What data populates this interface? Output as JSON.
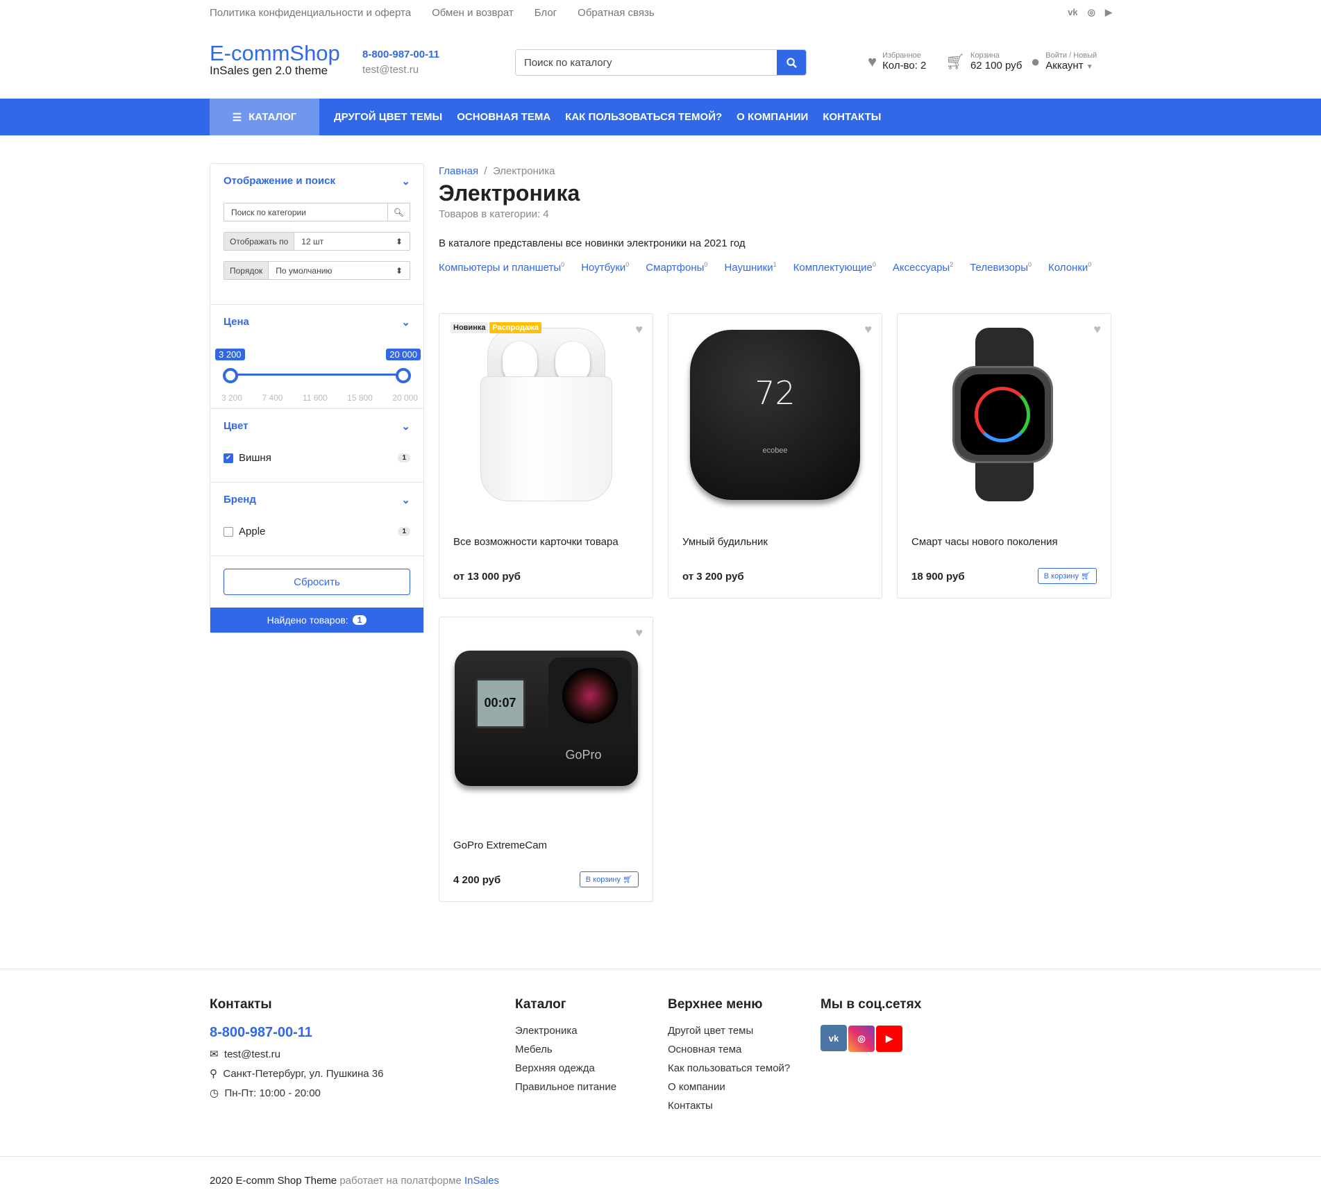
{
  "topbar": {
    "links": [
      "Политика конфиденциальности и оферта",
      "Обмен и возврат",
      "Блог",
      "Обратная связь"
    ],
    "socials": [
      "vk-icon",
      "instagram-icon",
      "youtube-icon"
    ]
  },
  "header": {
    "logo_title": "E-commShop",
    "logo_sub": "InSales gen 2.0 theme",
    "phone": "8-800-987-00-11",
    "email": "test@test.ru",
    "search_placeholder": "Поиск по каталогу",
    "favorites": {
      "label": "Избранное",
      "value": "Кол-во: 2"
    },
    "cart": {
      "label": "Корзина",
      "value": "62 100 руб"
    },
    "account": {
      "label": "Войти / Новый",
      "value": "Аккаунт"
    }
  },
  "nav": {
    "catalog": "КАТАЛОГ",
    "links": [
      "ДРУГОЙ ЦВЕТ ТЕМЫ",
      "ОСНОВНАЯ ТЕМА",
      "КАК ПОЛЬЗОВАТЬСЯ ТЕМОЙ?",
      "О КОМПАНИИ",
      "КОНТАКТЫ"
    ],
    "color": "#3068e8"
  },
  "sidebar": {
    "display": {
      "title": "Отображение и поиск",
      "search_placeholder": "Поиск по категории",
      "per_page_label": "Отображать по",
      "per_page_value": "12 шт",
      "order_label": "Порядок",
      "order_value": "По умолчанию"
    },
    "price": {
      "title": "Цена",
      "min": "3 200",
      "max": "20 000",
      "ticks": [
        "3 200",
        "7 400",
        "11 600",
        "15 800",
        "20 000"
      ]
    },
    "color": {
      "title": "Цвет",
      "options": [
        {
          "label": "Вишня",
          "count": "1",
          "checked": true
        }
      ]
    },
    "brand": {
      "title": "Бренд",
      "options": [
        {
          "label": "Apple",
          "count": "1",
          "checked": false
        }
      ]
    },
    "reset": "Сбросить",
    "found_label": "Найдено товаров:",
    "found_count": "1"
  },
  "main": {
    "breadcrumb": [
      "Главная",
      "Электроника"
    ],
    "title": "Электроника",
    "count": "Товаров в категории: 4",
    "description": "В каталоге представлены все новинки электроники на 2021 год",
    "categories": [
      {
        "name": "Компьютеры и планшеты",
        "count": "0"
      },
      {
        "name": "Ноутбуки",
        "count": "0"
      },
      {
        "name": "Смартфоны",
        "count": "0"
      },
      {
        "name": "Наушники",
        "count": "1"
      },
      {
        "name": "Комплектующие",
        "count": "0"
      },
      {
        "name": "Аксессуары",
        "count": "2"
      },
      {
        "name": "Телевизоры",
        "count": "0"
      },
      {
        "name": "Колонки",
        "count": "0"
      }
    ],
    "products": [
      {
        "name": "Все возможности карточки товара",
        "price": "от 13 000 руб",
        "badges": [
          "Новинка",
          "Распродажа"
        ]
      },
      {
        "name": "Умный будильник",
        "price": "от 3 200 руб",
        "screen": "72",
        "brand": "ecobee"
      },
      {
        "name": "Смарт часы нового поколения",
        "price": "18 900 руб",
        "cart": "В корзину"
      },
      {
        "name": "GoPro ExtremeCam",
        "price": "4 200 руб",
        "cart": "В корзину",
        "brand": "GoPro",
        "screen": "00:07"
      }
    ]
  },
  "footer": {
    "contacts": {
      "title": "Контакты",
      "phone": "8-800-987-00-11",
      "email": "test@test.ru",
      "address": "Санкт-Петербург, ул. Пушкина 36",
      "hours": "Пн-Пт: 10:00 - 20:00"
    },
    "catalog": {
      "title": "Каталог",
      "links": [
        "Электроника",
        "Мебель",
        "Верхняя одежда",
        "Правильное питание"
      ]
    },
    "menu": {
      "title": "Верхнее меню",
      "links": [
        "Другой цвет темы",
        "Основная тема",
        "Как пользоваться темой?",
        "О компании",
        "Контакты"
      ]
    },
    "social": {
      "title": "Мы в соц.сетях"
    },
    "copyright": "2020 E-comm Shop Theme",
    "powered": "работает на полатформе",
    "platform": "InSales"
  }
}
